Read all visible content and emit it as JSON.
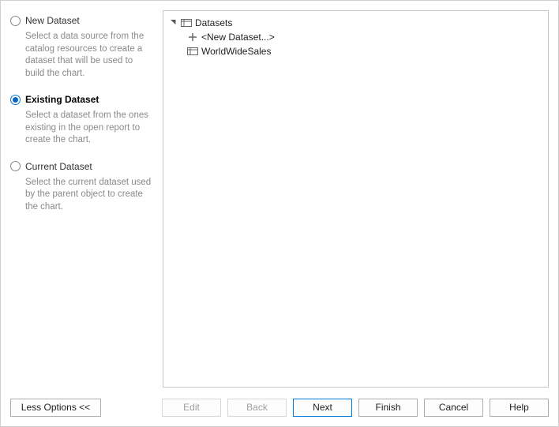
{
  "options": {
    "new": {
      "title": "New Dataset",
      "desc": "Select a data source from the catalog resources to create a dataset that will be used to build the chart."
    },
    "existing": {
      "title": "Existing Dataset",
      "desc": "Select a dataset from the ones existing in the open report to create the chart."
    },
    "current": {
      "title": "Current Dataset",
      "desc": "Select the current dataset used by the parent object to create the chart."
    }
  },
  "tree": {
    "root": "Datasets",
    "new_item": "<New Dataset...>",
    "item1": "WorldWideSales"
  },
  "buttons": {
    "less_options": "Less Options <<",
    "edit": "Edit",
    "back": "Back",
    "next": "Next",
    "finish": "Finish",
    "cancel": "Cancel",
    "help": "Help"
  }
}
